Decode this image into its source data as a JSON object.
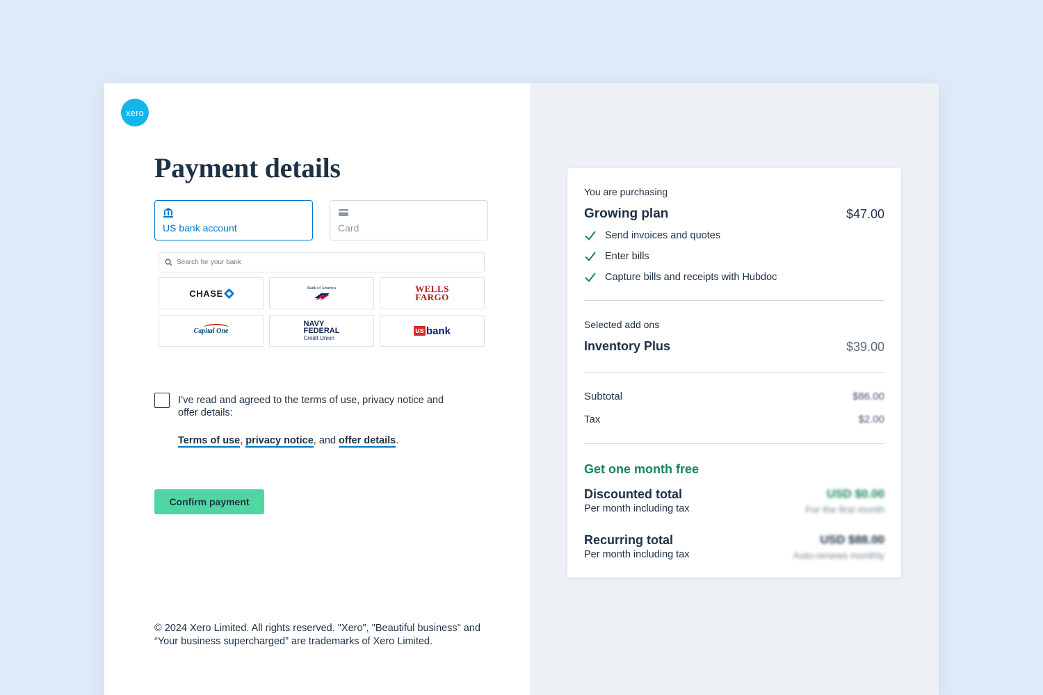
{
  "brand": {
    "logo_text": "xero",
    "color": "#13b5ea"
  },
  "page": {
    "title": "Payment details"
  },
  "payment_methods": [
    {
      "label": "US bank account",
      "icon": "bank-icon",
      "selected": true
    },
    {
      "label": "Card",
      "icon": "credit-card-icon",
      "selected": false
    }
  ],
  "bank_search": {
    "placeholder": "Search for your bank"
  },
  "banks": [
    {
      "name": "CHASE"
    },
    {
      "name": "Bank of America"
    },
    {
      "name": "WELLS FARGO",
      "line1": "WELLS",
      "line2": "FARGO"
    },
    {
      "name": "Capital One"
    },
    {
      "name": "NAVY FEDERAL Credit Union",
      "line1": "NAVY",
      "line2": "FEDERAL",
      "line3": "Credit Union"
    },
    {
      "name": "usbank",
      "prefix": "us",
      "suffix": "bank"
    }
  ],
  "agreement": {
    "text": "I’ve read and agreed to the terms of use, privacy notice and offer details:",
    "terms_link": "Terms of use",
    "privacy_link": "privacy notice",
    "offer_link": "offer details",
    "sep1": ",",
    "sep2": ", and",
    "end": "."
  },
  "confirm_button": "Confirm payment",
  "footer": "© 2024 Xero Limited. All rights reserved. \"Xero\", \"Beautiful business\" and “Your business supercharged” are trademarks of Xero Limited.",
  "summary": {
    "purchasing_label": "You are purchasing",
    "plan_name": "Growing plan",
    "plan_price": "$47.00",
    "features": [
      "Send invoices and quotes",
      "Enter bills",
      "Capture bills and receipts with Hubdoc"
    ],
    "addons_label": "Selected add ons",
    "addon_name": "Inventory Plus",
    "addon_price": "$39.00",
    "subtotal_label": "Subtotal",
    "subtotal_value": "$86.00",
    "tax_label": "Tax",
    "tax_value": "$2.00",
    "promo": "Get one month free",
    "discounted_label": "Discounted total",
    "discounted_sub": "Per month including tax",
    "discounted_value": "USD $0.00",
    "discounted_note": "For the first month",
    "recurring_label": "Recurring total",
    "recurring_sub": "Per month including tax",
    "recurring_value": "USD $88.00",
    "recurring_note": "Auto-renews monthly"
  },
  "colors": {
    "background": "#dfeaf8",
    "accent_blue": "#0078c8",
    "confirm_green": "#4fd6a2",
    "promo_green": "#168756",
    "text": "#1e3145"
  }
}
